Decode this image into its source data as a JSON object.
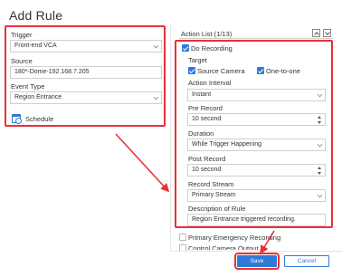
{
  "title": "Add Rule",
  "left": {
    "trigger_label": "Trigger",
    "trigger_value": "Front-end VCA",
    "source_label": "Source",
    "source_value": "180*-Dome-192.168.7.205",
    "event_type_label": "Event Type",
    "event_type_value": "Region Entrance",
    "schedule_label": "Schedule"
  },
  "action_list": {
    "header": "Action List (1/13)",
    "do_recording": "Do Recording",
    "target_label": "Target",
    "source_camera": "Source Camera",
    "one_to_one": "One-to-one",
    "action_interval_label": "Action Interval",
    "action_interval_value": "Instant",
    "pre_record_label": "Pre Record",
    "pre_record_value": "10 second",
    "duration_label": "Duration",
    "duration_value": "While Trigger Happening",
    "post_record_label": "Post Record",
    "post_record_value": "10 second",
    "record_stream_label": "Record Stream",
    "record_stream_value": "Primary Stream",
    "description_label": "Description of Rule",
    "description_value": "Region Entrance triggered recording.",
    "primary_emergency": "Primary Emergency Recording",
    "control_camera_output": "Control Camera Output"
  },
  "buttons": {
    "save": "Save",
    "cancel": "Cancel"
  },
  "colors": {
    "accent": "#2d7bd9",
    "highlight": "#e8303a"
  }
}
